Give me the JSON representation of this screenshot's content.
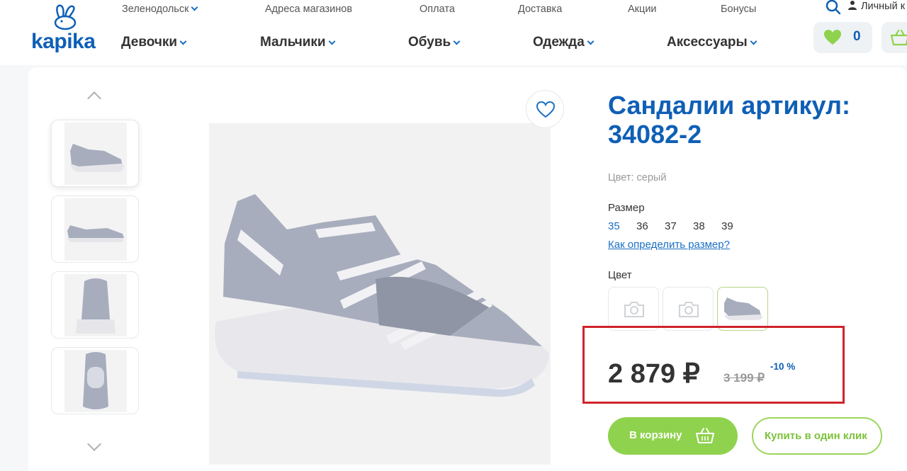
{
  "header": {
    "logo_text": "kapika",
    "city": "Зеленодольск",
    "top_links": [
      "Адреса магазинов",
      "Оплата",
      "Доставка",
      "Акции",
      "Бонусы"
    ],
    "account_label": "Личный к",
    "categories": [
      "Девочки",
      "Мальчики",
      "Обувь",
      "Одежда",
      "Аксессуары"
    ],
    "favorites_count": "0"
  },
  "gallery": {
    "thumb_icons": [
      "sandal-side-thumb",
      "sandal-profile-thumb",
      "sandal-back-thumb",
      "sandal-top-thumb"
    ]
  },
  "product": {
    "title": "Сандалии артикул: 34082-2",
    "color_line": "Цвет: серый",
    "size_label": "Размер",
    "sizes": [
      "35",
      "36",
      "37",
      "38",
      "39"
    ],
    "selected_size": "35",
    "size_help": "Как определить размер?",
    "color_label": "Цвет",
    "price": "2 879 ₽",
    "old_price": "3 199 ₽",
    "discount": "-10 %",
    "add_to_cart": "В корзину",
    "buy_one_click": "Купить в один клик"
  },
  "colors": {
    "brand_blue": "#0f5fb5",
    "link_blue": "#1a6fc4",
    "cta_green": "#8fd24d",
    "highlight_red": "#d0232b",
    "sandal_grey": "#a7adbd"
  }
}
